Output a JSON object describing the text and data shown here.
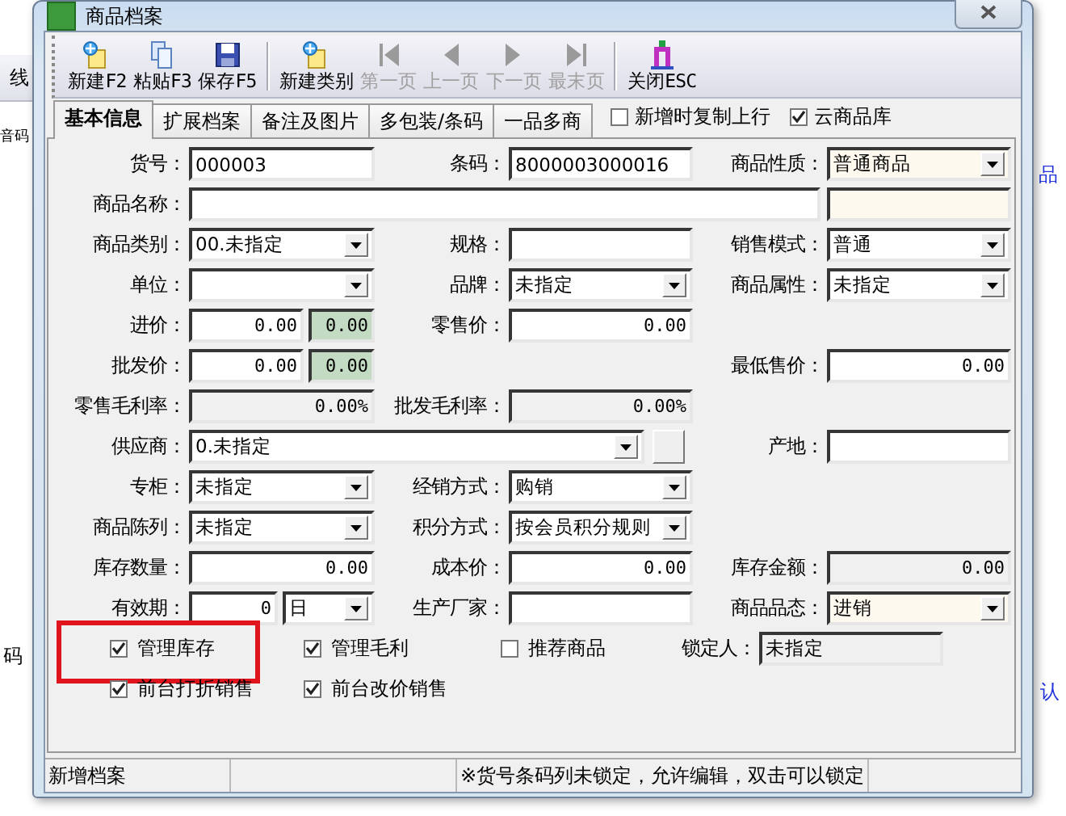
{
  "backdrop": {
    "texts": [
      {
        "text": "线",
        "kind": "plain"
      },
      {
        "text": "音码",
        "kind": "plain"
      },
      {
        "text": "码",
        "kind": "plain"
      },
      {
        "text": "品",
        "kind": "link"
      },
      {
        "text": "认",
        "kind": "link"
      }
    ]
  },
  "window": {
    "title": "商品档案"
  },
  "toolbar": {
    "buttons": [
      {
        "label": "新建F2",
        "kind": "new",
        "disabled": false
      },
      {
        "label": "粘贴F3",
        "kind": "paste",
        "disabled": false
      },
      {
        "label": "保存F5",
        "kind": "save",
        "disabled": false
      },
      {
        "label": "新建类别",
        "kind": "new",
        "disabled": false,
        "group_start": true
      },
      {
        "label": "第一页",
        "kind": "first",
        "disabled": true
      },
      {
        "label": "上一页",
        "kind": "prev",
        "disabled": true
      },
      {
        "label": "下一页",
        "kind": "next",
        "disabled": true
      },
      {
        "label": "最末页",
        "kind": "last",
        "disabled": true
      },
      {
        "label": "关闭ESC",
        "kind": "close",
        "disabled": false,
        "group_start": true
      }
    ]
  },
  "tabs": [
    {
      "label": "基本信息",
      "selected": true
    },
    {
      "label": "扩展档案",
      "selected": false
    },
    {
      "label": "备注及图片",
      "selected": false
    },
    {
      "label": "多包装/条码",
      "selected": false
    },
    {
      "label": "一品多商",
      "selected": false
    }
  ],
  "tab_options": [
    {
      "label": "新增时复制上行",
      "checked": false
    },
    {
      "label": "云商品库",
      "checked": true
    }
  ],
  "form_rows": [
    [
      {
        "label": "货号：",
        "kind": "text",
        "value": "000003"
      },
      {
        "label": "条码：",
        "kind": "text",
        "value": "8000003000016"
      },
      {
        "label": "商品性质：",
        "kind": "dropdown_tinted",
        "value": "普通商品"
      }
    ],
    [
      {
        "label": "商品名称：",
        "kind": "wide_text"
      },
      {
        "kind": "tinted"
      }
    ],
    [
      {
        "label": "商品类别：",
        "kind": "dropdown",
        "value": "00.未指定"
      },
      {
        "label": "规格：",
        "kind": "text"
      },
      {
        "label": "销售模式：",
        "kind": "dropdown",
        "value": "普通"
      }
    ],
    [
      {
        "label": "单位：",
        "kind": "dropdown"
      },
      {
        "label": "品牌：",
        "kind": "dropdown",
        "value": "未指定"
      },
      {
        "label": "商品属性：",
        "kind": "dropdown",
        "value": "未指定"
      }
    ],
    [
      {
        "label": "进价：",
        "kind": "price_pair",
        "value": "0.00",
        "value_2": "0.00"
      },
      {
        "label": "零售价：",
        "kind": "number",
        "value": "0.00"
      },
      null
    ],
    [
      {
        "label": "批发价：",
        "kind": "price_pair",
        "value": "0.00",
        "value_2": "0.00"
      },
      null,
      {
        "label": "最低售价：",
        "kind": "number",
        "value": "0.00"
      }
    ],
    [
      {
        "label": "零售毛利率：",
        "kind": "readonly",
        "value": "0.00%"
      },
      {
        "label": "批发毛利率：",
        "kind": "readonly",
        "value": "0.00%"
      },
      null
    ],
    [
      {
        "label": "供应商：",
        "kind": "supplier",
        "value": "0.未指定"
      },
      {
        "label": "产地：",
        "kind": "text"
      }
    ],
    [
      {
        "label": "专柜：",
        "kind": "dropdown",
        "value": "未指定"
      },
      {
        "label": "经销方式：",
        "kind": "dropdown",
        "value": "购销"
      },
      null
    ],
    [
      {
        "label": "商品陈列：",
        "kind": "dropdown",
        "value": "未指定"
      },
      {
        "label": "积分方式：",
        "kind": "dropdown",
        "value": "按会员积分规则"
      },
      null
    ],
    [
      {
        "label": "库存数量：",
        "kind": "number",
        "value": "0.00"
      },
      {
        "label": "成本价：",
        "kind": "number",
        "value": "0.00"
      },
      {
        "label": "库存金额：",
        "kind": "readonly",
        "value": "0.00"
      }
    ],
    [
      {
        "label": "有效期：",
        "kind": "period",
        "value": "0",
        "unit": "日"
      },
      {
        "label": "生产厂家：",
        "kind": "text"
      },
      {
        "label": "商品品态：",
        "kind": "dropdown_tinted",
        "value": "进销"
      }
    ]
  ],
  "options": [
    {
      "label": "管理库存",
      "checked": true,
      "highlighted": true
    },
    {
      "label": "管理毛利",
      "checked": true,
      "highlighted": false
    },
    {
      "label": "推荐商品",
      "checked": false,
      "highlighted": false
    },
    {
      "label": "前台打折销售",
      "checked": true,
      "highlighted": false
    },
    {
      "label": "前台改价销售",
      "checked": true,
      "highlighted": false
    }
  ],
  "locker": {
    "label": "锁定人：",
    "value": "未指定"
  },
  "status_bar": [
    "新增档案",
    "※货号条码列未锁定，允许编辑，双击可以锁定"
  ]
}
